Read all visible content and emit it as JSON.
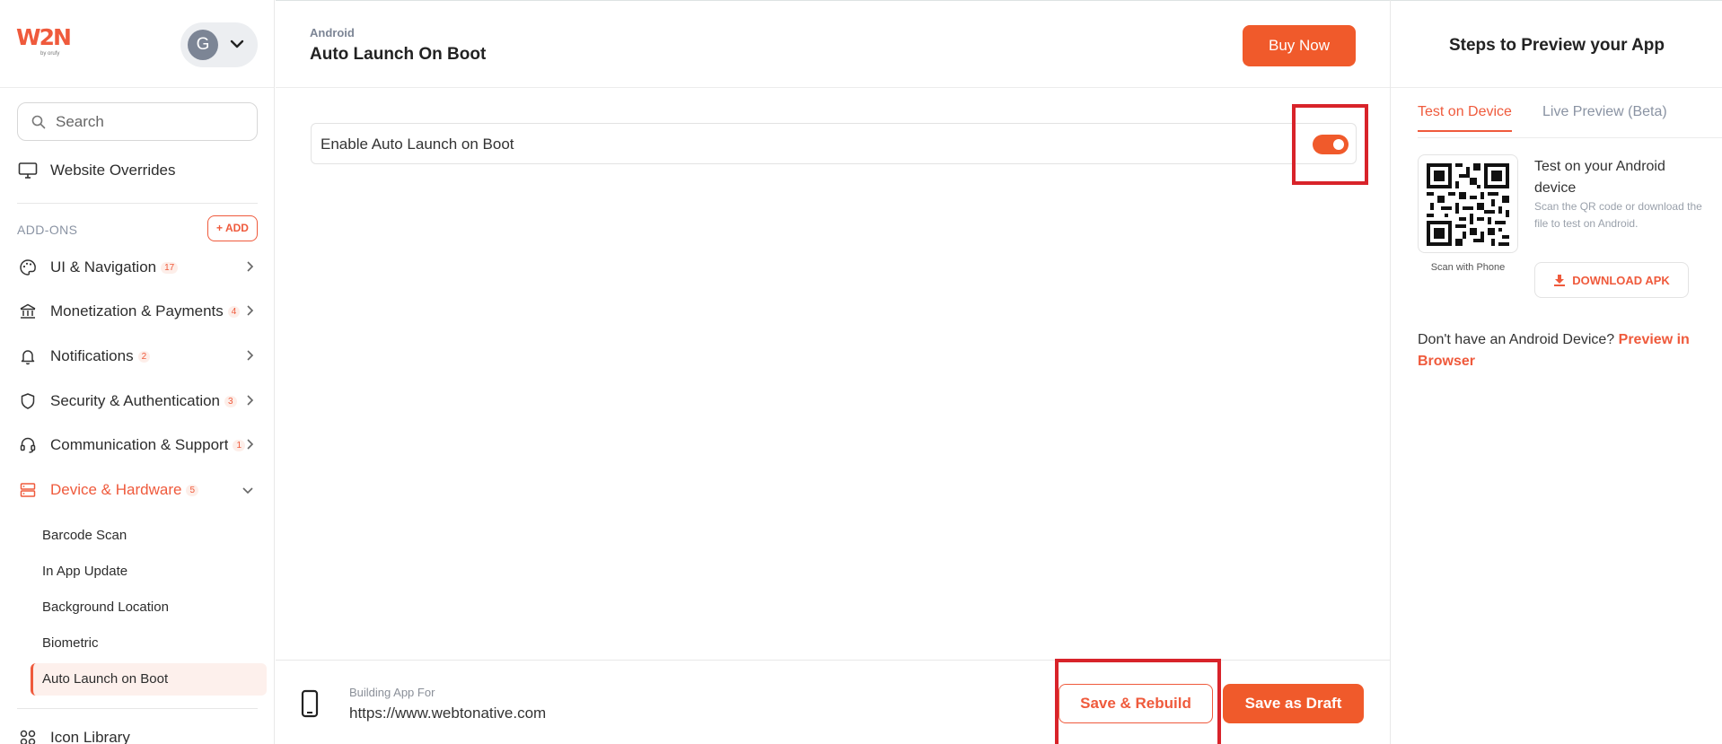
{
  "brand": {
    "logo_text": "W2N",
    "logo_sub": "by orufy",
    "accent": "#f05a2b",
    "highlight": "#d8232a"
  },
  "account": {
    "avatar_letter": "G"
  },
  "search": {
    "placeholder": "Search"
  },
  "sidebar": {
    "website_overrides": "Website Overrides",
    "addons_label": "ADD-ONS",
    "add_label": "ADD",
    "items": [
      {
        "label": "UI & Navigation",
        "count": "17",
        "icon": "palette-icon"
      },
      {
        "label": "Monetization & Payments",
        "count": "4",
        "icon": "bank-icon"
      },
      {
        "label": "Notifications",
        "count": "2",
        "icon": "bell-icon"
      },
      {
        "label": "Security & Authentication",
        "count": "3",
        "icon": "shield-icon"
      },
      {
        "label": "Communication & Support",
        "count": "1",
        "icon": "headset-icon"
      },
      {
        "label": "Device & Hardware",
        "count": "5",
        "icon": "device-icon",
        "expanded": true
      }
    ],
    "sub_items": [
      "Barcode Scan",
      "In App Update",
      "Background Location",
      "Biometric",
      "Auto Launch on Boot"
    ],
    "active_sub": "Auto Launch on Boot",
    "icon_library": "Icon Library"
  },
  "header": {
    "breadcrumb": "Android",
    "title": "Auto Launch On Boot",
    "buy_now": "Buy Now"
  },
  "main": {
    "setting_label": "Enable Auto Launch on Boot",
    "toggle_on": true
  },
  "footer": {
    "building_for": "Building App For",
    "url": "https://www.webtonative.com",
    "save_rebuild": "Save & Rebuild",
    "save_draft": "Save as Draft"
  },
  "preview": {
    "title": "Steps to Preview your App",
    "tabs": [
      "Test on Device",
      "Live Preview (Beta)"
    ],
    "active_tab": "Test on Device",
    "qr_caption": "Scan with Phone",
    "test_title": "Test on your Android device",
    "test_desc": "Scan the QR code or download the file to test on Android.",
    "download": "DOWNLOAD APK",
    "no_device": "Don't have an Android Device?",
    "preview_link": "Preview in Browser"
  }
}
